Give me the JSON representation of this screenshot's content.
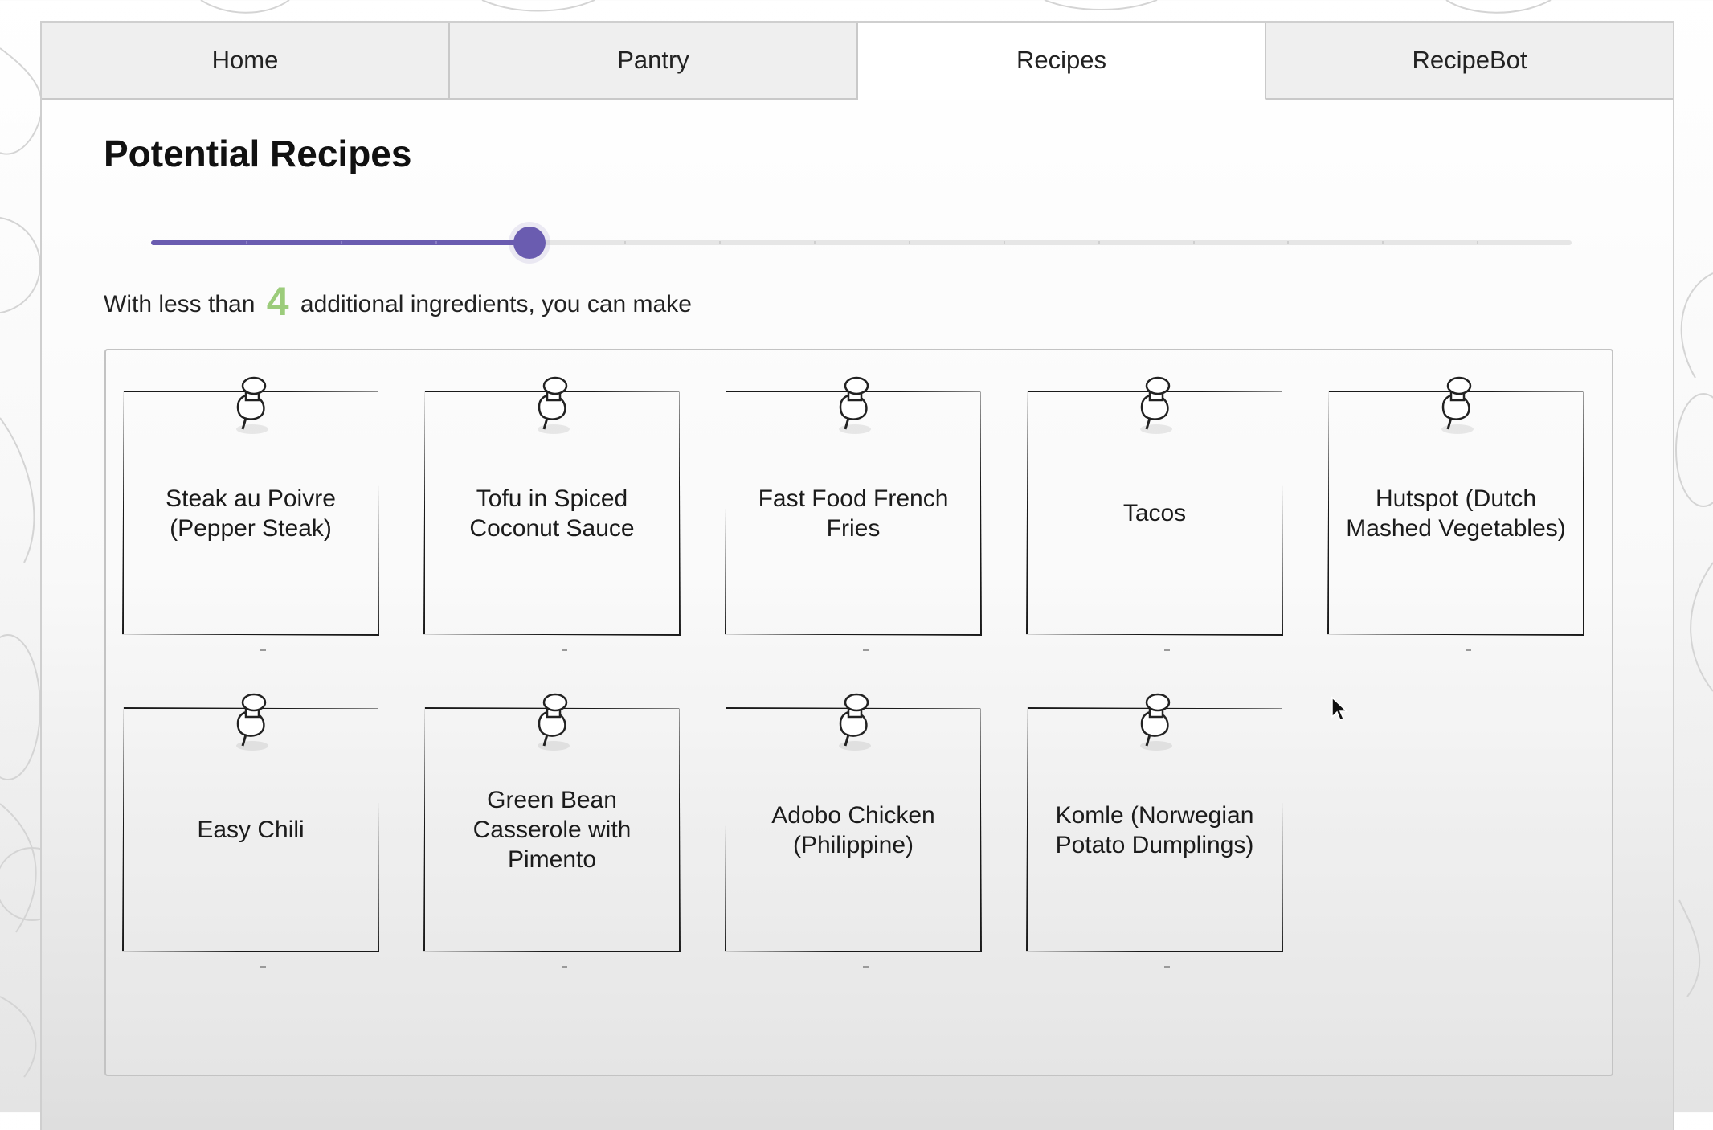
{
  "tabs": [
    {
      "label": "Home",
      "active": false
    },
    {
      "label": "Pantry",
      "active": false
    },
    {
      "label": "Recipes",
      "active": true
    },
    {
      "label": "RecipeBot",
      "active": false
    }
  ],
  "page": {
    "title": "Potential Recipes",
    "slider": {
      "value": 4,
      "min": 0,
      "max": 15,
      "color": "#6a5cb0"
    },
    "caption": {
      "prefix": "With less than",
      "count": "4",
      "suffix": "additional ingredients, you can make",
      "count_color": "#9ccc7b"
    }
  },
  "recipes": [
    {
      "name": "Steak au Poivre (Pepper Steak)"
    },
    {
      "name": "Tofu in Spiced Coconut Sauce"
    },
    {
      "name": "Fast Food French Fries"
    },
    {
      "name": "Tacos"
    },
    {
      "name": "Hutspot (Dutch Mashed Vegetables)"
    },
    {
      "name": "Easy Chili"
    },
    {
      "name": "Green Bean Casserole with Pimento"
    },
    {
      "name": "Adobo Chicken (Philippine)"
    },
    {
      "name": "Komle (Norwegian Potato Dumplings)"
    }
  ],
  "icons": {
    "pin": "pushpin-icon",
    "cursor": "mouse-pointer-icon"
  }
}
